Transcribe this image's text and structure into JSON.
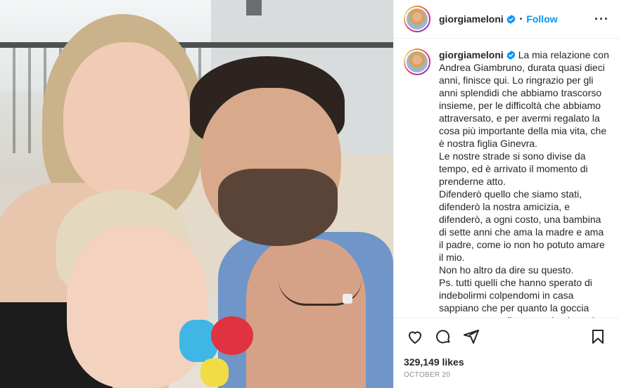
{
  "post": {
    "username": "giorgiameloni",
    "follow_label": "Follow",
    "more_icon": "more-options-icon",
    "caption_lines": [
      "La mia relazione con Andrea Giambruno, durata quasi dieci anni, finisce qui. Lo ringrazio per gli anni splendidi che abbiamo trascorso insieme, per le difficoltà che abbiamo attraversato, e per avermi regalato la cosa più importante della mia vita, che è nostra figlia Ginevra.",
      "Le nostre strade si sono divise da tempo, ed è arrivato il momento di prenderne atto.",
      "Difenderò quello che siamo stati, difenderò la nostra amicizia, e difenderò, a ogni costo, una bambina di sette anni che ama la madre e ama il padre, come io non ho potuto amare il mio.",
      "Non ho altro da dire su questo.",
      "Ps. tutti quelli che hanno sperato di indebolirmi colpendomi in casa sappiano che per quanto la goccia possa sperare di scavare la pietra, la"
    ],
    "likes": "329,149 likes",
    "date": "OCTOBER 20",
    "icons": [
      "heart-icon",
      "comment-icon",
      "share-icon",
      "bookmark-icon"
    ],
    "colors": {
      "accent": "#0095f6",
      "verified": "#0095f6",
      "muted": "#8e8e8e"
    }
  }
}
